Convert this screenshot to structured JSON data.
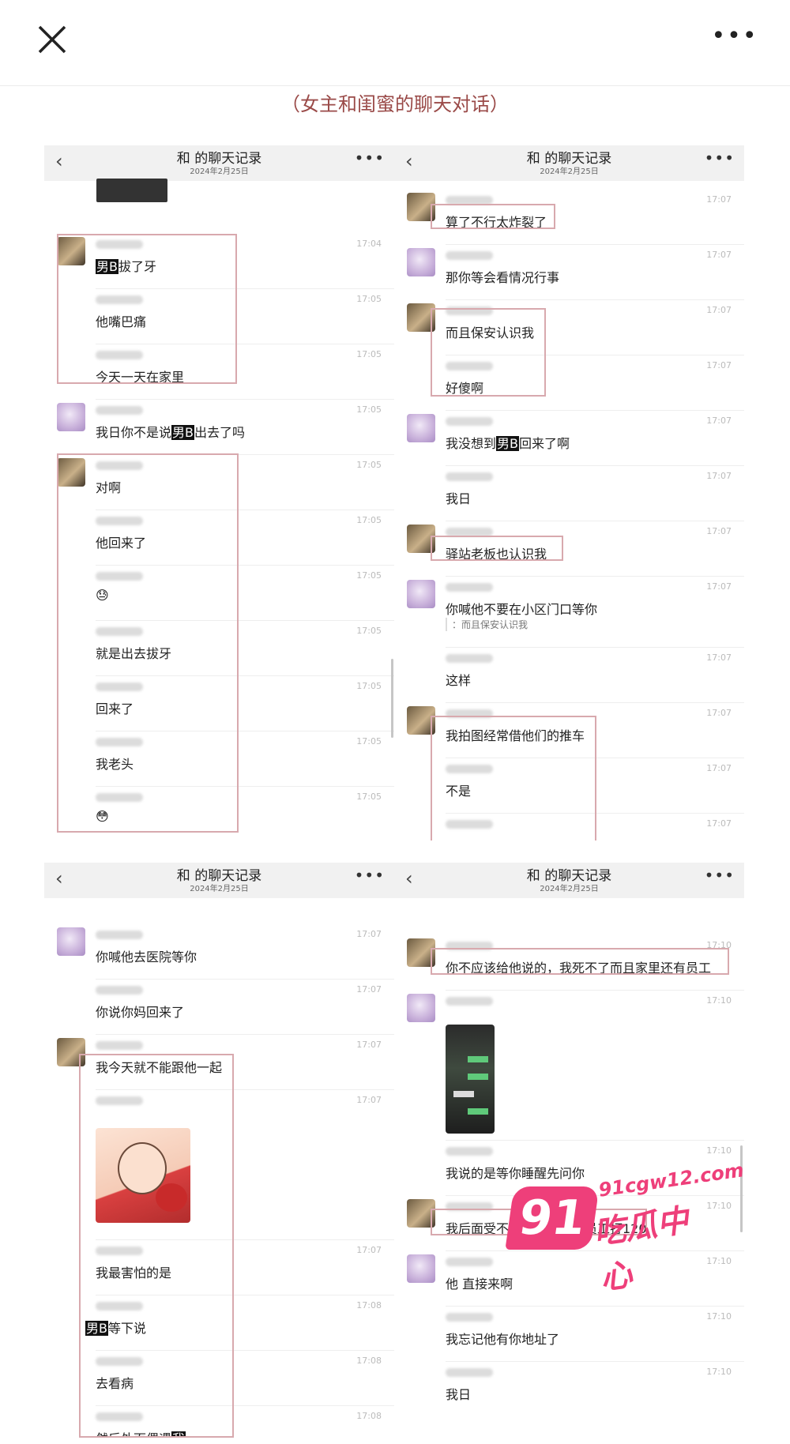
{
  "topbar": {
    "more_label": "•••"
  },
  "caption": "（女主和闺蜜的聊天对话）",
  "panels": [
    {
      "title": "和  的聊天记录",
      "date": "2024年2月25日",
      "messages": [
        {
          "time": "17:04",
          "text_a": "",
          "highlight": "男B",
          "text_b": "拔了牙"
        },
        {
          "time": "17:05",
          "text": "他嘴巴痛"
        },
        {
          "time": "17:05",
          "text": "今天一天在家里"
        },
        {
          "time": "17:05",
          "text_a": "我日你不是说",
          "highlight": "男B",
          "text_b": "出去了吗"
        },
        {
          "time": "17:05",
          "text": "对啊"
        },
        {
          "time": "17:05",
          "text": "他回来了"
        },
        {
          "time": "17:05",
          "text": "😓"
        },
        {
          "time": "17:05",
          "text": "就是出去拔牙"
        },
        {
          "time": "17:05",
          "text": "回来了"
        },
        {
          "time": "17:05",
          "text": "我老头"
        },
        {
          "time": "17:05",
          "text": "😳"
        }
      ]
    },
    {
      "title": "和  的聊天记录",
      "date": "2024年2月25日",
      "messages": [
        {
          "time": "17:07",
          "text": "算了不行太炸裂了"
        },
        {
          "time": "17:07",
          "text": "那你等会看情况行事"
        },
        {
          "time": "17:07",
          "text": "而且保安认识我"
        },
        {
          "time": "17:07",
          "text": "好傻啊"
        },
        {
          "time": "17:07",
          "text_a": "我没想到",
          "highlight": "男B",
          "text_b": "回来了啊"
        },
        {
          "time": "17:07",
          "text": "我日"
        },
        {
          "time": "17:07",
          "text": "驿站老板也认识我"
        },
        {
          "time": "17:07",
          "text": "你喊他不要在小区门口等你",
          "quote": "：而且保安认识我"
        },
        {
          "time": "17:07",
          "text": "这样"
        },
        {
          "time": "17:07",
          "text": "我拍图经常借他们的推车"
        },
        {
          "time": "17:07",
          "text": "不是"
        },
        {
          "time": "17:07",
          "text": ""
        }
      ]
    },
    {
      "title": "和  的聊天记录",
      "date": "2024年2月25日",
      "messages": [
        {
          "time": "17:07",
          "text": "你喊他去医院等你"
        },
        {
          "time": "17:07",
          "text": "你说你妈回来了"
        },
        {
          "time": "17:07",
          "text": "我今天就不能跟他一起"
        },
        {
          "time": "17:07",
          "text": ""
        },
        {
          "time": "17:07",
          "text": "我最害怕的是"
        },
        {
          "time": "17:08",
          "text_a": "",
          "highlight": "男B",
          "text_b": "等下说"
        },
        {
          "time": "17:08",
          "text": "去看病"
        },
        {
          "time": "17:08",
          "text_a": "然后外面偶遇",
          "highlight": "我",
          "text_b": ""
        }
      ]
    },
    {
      "title": "和  的聊天记录",
      "date": "2024年2月25日",
      "messages": [
        {
          "time": "17:10",
          "text": "你不应该给他说的，我死不了而且家里还有员工"
        },
        {
          "time": "17:10",
          "text": ""
        },
        {
          "time": "17:10",
          "text": "我说的是等你睡醒先问你"
        },
        {
          "time": "17:10",
          "text": "我后面受不了了还可以叫员工打120"
        },
        {
          "time": "17:10",
          "text": "他 直接来啊"
        },
        {
          "time": "17:10",
          "text": "我忘记他有你地址了"
        },
        {
          "time": "17:10",
          "text": "我日"
        }
      ]
    }
  ],
  "watermark": {
    "badge": "91",
    "site": "91cgw12.com",
    "name": "吃瓜中心"
  }
}
